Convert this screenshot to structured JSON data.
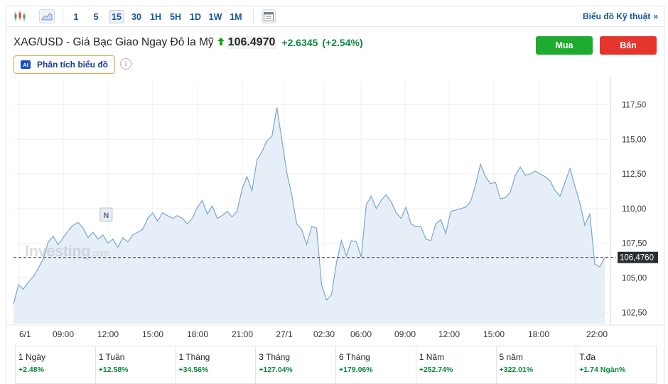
{
  "toolbar": {
    "intervals": [
      "1",
      "5",
      "15",
      "30",
      "1H",
      "5H",
      "1D",
      "1W",
      "1M"
    ],
    "active_interval": "15",
    "tech_link": "Biểu đồ Kỹ thuật",
    "tech_chevron": "»",
    "icons": [
      "candlestick-chart-icon",
      "area-chart-icon",
      "calendar-icon"
    ]
  },
  "instrument": {
    "name": "XAG/USD - Giá Bạc Giao Ngay Đô la Mỹ",
    "direction_icon": "up-arrow-icon",
    "price": "106.4970",
    "change": "+2.6345",
    "change_pct": "(+2.54%)"
  },
  "actions": {
    "buy": "Mua",
    "sell": "Bán"
  },
  "ai": {
    "badge": "AI",
    "label": "Phân tích biểu đồ"
  },
  "watermark": {
    "brand": "Investing",
    "suffix": ".com"
  },
  "chart_data": {
    "type": "area",
    "x_tick_labels": [
      "6/1",
      "09:00",
      "12:00",
      "15:00",
      "18:00",
      "21:00",
      "27/1",
      "02:30",
      "06:00",
      "09:00",
      "12:00",
      "15:00",
      "18:00",
      "22:00"
    ],
    "y_ticks": [
      102.5,
      105.0,
      107.5,
      110.0,
      112.5,
      115.0,
      117.5
    ],
    "y_tick_labels": [
      "102,50",
      "105,00",
      "107,50",
      "110,00",
      "112,50",
      "115,00",
      "117,50"
    ],
    "ylim": [
      101.7,
      118.7
    ],
    "grid": true,
    "current_value": 106.476,
    "current_label": "106,4760",
    "marker_label": "N",
    "colors": {
      "line": "#7aa7cf",
      "fill": "#e6eff7",
      "grid": "#eef0f2",
      "price_line": "#333333"
    },
    "values": [
      103.1,
      104.5,
      104.2,
      104.7,
      105.1,
      105.7,
      106.4,
      107.6,
      108.0,
      107.4,
      107.9,
      108.4,
      108.8,
      109.0,
      108.6,
      107.9,
      108.3,
      107.8,
      108.1,
      107.5,
      107.8,
      107.2,
      107.9,
      107.6,
      108.1,
      108.3,
      108.5,
      109.3,
      109.7,
      109.1,
      109.7,
      109.5,
      109.3,
      109.5,
      109.3,
      108.9,
      109.3,
      110.1,
      110.6,
      109.6,
      110.2,
      109.3,
      109.5,
      109.8,
      109.4,
      109.8,
      111.4,
      112.3,
      111.3,
      113.5,
      114.1,
      114.9,
      115.2,
      117.3,
      115.0,
      112.6,
      111.0,
      108.9,
      108.5,
      107.4,
      108.7,
      108.6,
      104.5,
      103.4,
      103.8,
      106.1,
      107.7,
      106.6,
      107.7,
      107.6,
      106.5,
      110.3,
      110.9,
      110.0,
      110.6,
      111.0,
      110.5,
      109.7,
      109.3,
      110.1,
      108.9,
      108.7,
      108.7,
      107.8,
      107.7,
      108.9,
      109.2,
      108.2,
      109.8,
      109.9,
      110.0,
      110.1,
      110.5,
      111.7,
      113.2,
      112.3,
      111.8,
      111.9,
      110.7,
      110.8,
      111.2,
      112.4,
      113.0,
      112.4,
      112.5,
      112.7,
      112.5,
      112.3,
      112.0,
      111.3,
      110.9,
      111.9,
      112.9,
      111.6,
      110.4,
      108.8,
      109.6,
      106.0,
      105.8,
      106.476
    ]
  },
  "performance": [
    {
      "label": "1 Ngày",
      "value": "+2.48%"
    },
    {
      "label": "1 Tuần",
      "value": "+12.58%"
    },
    {
      "label": "1 Tháng",
      "value": "+34.56%"
    },
    {
      "label": "3 Tháng",
      "value": "+127.04%"
    },
    {
      "label": "6 Tháng",
      "value": "+179.06%"
    },
    {
      "label": "1 Năm",
      "value": "+252.74%"
    },
    {
      "label": "5 năm",
      "value": "+322.01%"
    },
    {
      "label": "T.đa",
      "value": "+1.74 Ngàn%"
    }
  ]
}
